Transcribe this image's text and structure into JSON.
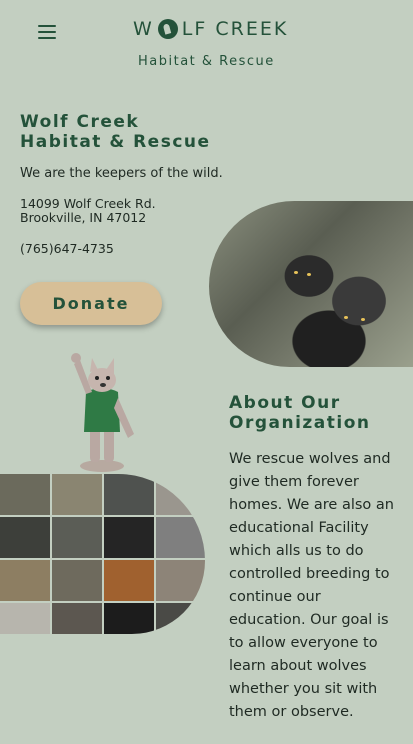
{
  "header": {
    "menu_icon": "hamburger-menu-icon",
    "logo_left": "W",
    "logo_right": "LF CREEK",
    "logo_sub": "Habitat & Rescue"
  },
  "hero": {
    "title_line1": "Wolf Creek",
    "title_line2": "Habitat & Rescue",
    "tagline": "We are the keepers of the wild.",
    "address_line1": "14099 Wolf Creek Rd.",
    "address_line2": "Brookville, IN 47012",
    "phone": "(765)647-4735",
    "donate_label": "Donate"
  },
  "about": {
    "title_line1": "About Our",
    "title_line2": "Organization",
    "text": "We rescue wolves and give them forever homes. We are also an educational Facility which alls us to do controlled breeding to continue our education. Our goal is to allow everyone to learn about wolves whether you sit with them or observe."
  },
  "colors": {
    "background": "#c3cfc1",
    "brand_green": "#24523a",
    "donate_bg": "#d7bf97"
  }
}
